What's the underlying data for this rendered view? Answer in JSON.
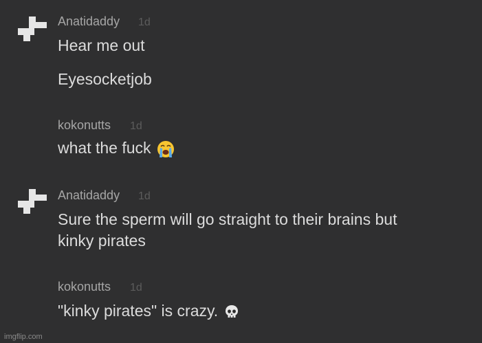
{
  "comments": [
    {
      "username": "Anatidaddy",
      "time": "1d",
      "lines": [
        "Hear me out",
        "Eyesocketjob"
      ]
    },
    {
      "username": "kokonutts",
      "time": "1d",
      "lines": [
        "what the fuck"
      ],
      "emoji": "loudly-crying-face-icon"
    },
    {
      "username": "Anatidaddy",
      "time": "1d",
      "lines": [
        "Sure the sperm will go straight to their brains but",
        "kinky pirates"
      ]
    },
    {
      "username": "kokonutts",
      "time": "1d",
      "lines": [
        "\"kinky pirates\" is crazy."
      ],
      "emoji": "skull-icon"
    }
  ],
  "watermark": "imgflip.com",
  "colors": {
    "background": "#2f2f30",
    "username": "#a6a6a6",
    "timestamp": "#5c5c5c",
    "message": "#dcdcdc",
    "avatar": "#e6e6e6"
  }
}
